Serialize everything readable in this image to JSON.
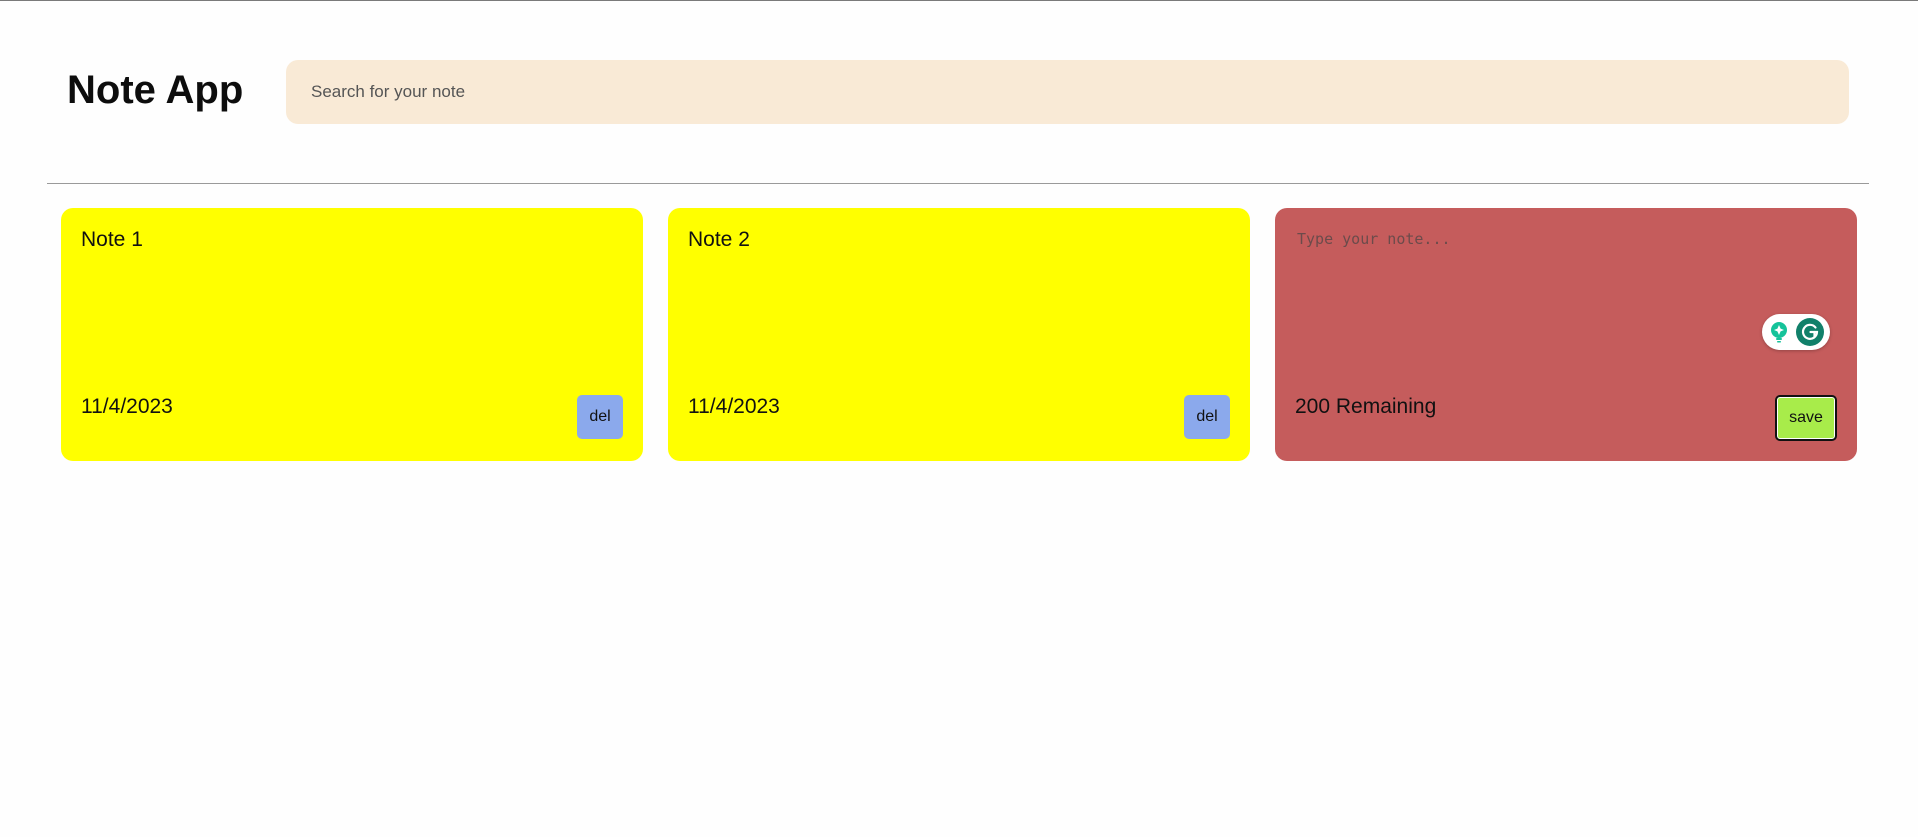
{
  "app": {
    "title": "Note App"
  },
  "search": {
    "placeholder": "Search for your note",
    "value": ""
  },
  "notes": [
    {
      "text": "Note 1",
      "date": "11/4/2023",
      "delete_label": "del",
      "color": "#ffff00"
    },
    {
      "text": "Note 2",
      "date": "11/4/2023",
      "delete_label": "del",
      "color": "#ffff00"
    }
  ],
  "new_note": {
    "placeholder": "Type your note...",
    "value": "",
    "remaining_text": "200 Remaining",
    "save_label": "save",
    "color": "#c55c5c",
    "assistant_icons": [
      "lightbulb-icon",
      "grammarly-icon"
    ]
  },
  "colors": {
    "search_background": "#f9ead6",
    "delete_button": "#8ba9ec",
    "save_button": "#a8ec4a"
  }
}
